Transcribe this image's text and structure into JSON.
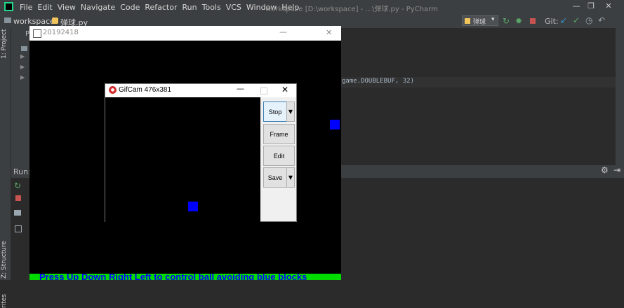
{
  "ide": {
    "menu": [
      "File",
      "Edit",
      "View",
      "Navigate",
      "Code",
      "Refactor",
      "Run",
      "Tools",
      "VCS",
      "Window",
      "Help"
    ],
    "window_title": "workspace [D:\\workspace] - ...\\弹球.py - PyCharm",
    "breadcrumb_project": "workspace",
    "breadcrumb_file": "弹球.py",
    "run_config": "弹球",
    "git_label": "Git:",
    "project_tab": "1: Project",
    "structure_tab": "Z: Structure",
    "favorites_tab": "rites",
    "run_label": "Run:",
    "project_item_prefix": "Pa",
    "code_line": "game.DOUBLEBUF, 32)"
  },
  "pygame": {
    "title": "20192418",
    "banner": "Press Up Down Right Left to control ball avoiding blue blocks"
  },
  "gifcam": {
    "title": "GifCam 476x381",
    "buttons": {
      "stop": "Stop",
      "frame": "Frame",
      "edit": "Edit",
      "save": "Save"
    }
  },
  "colors": {
    "ide_bg": "#2b2b2b",
    "ide_chrome": "#3c3f41",
    "block": "#0000ff",
    "banner_bg": "#00dc00",
    "banner_text": "#0000ff"
  }
}
